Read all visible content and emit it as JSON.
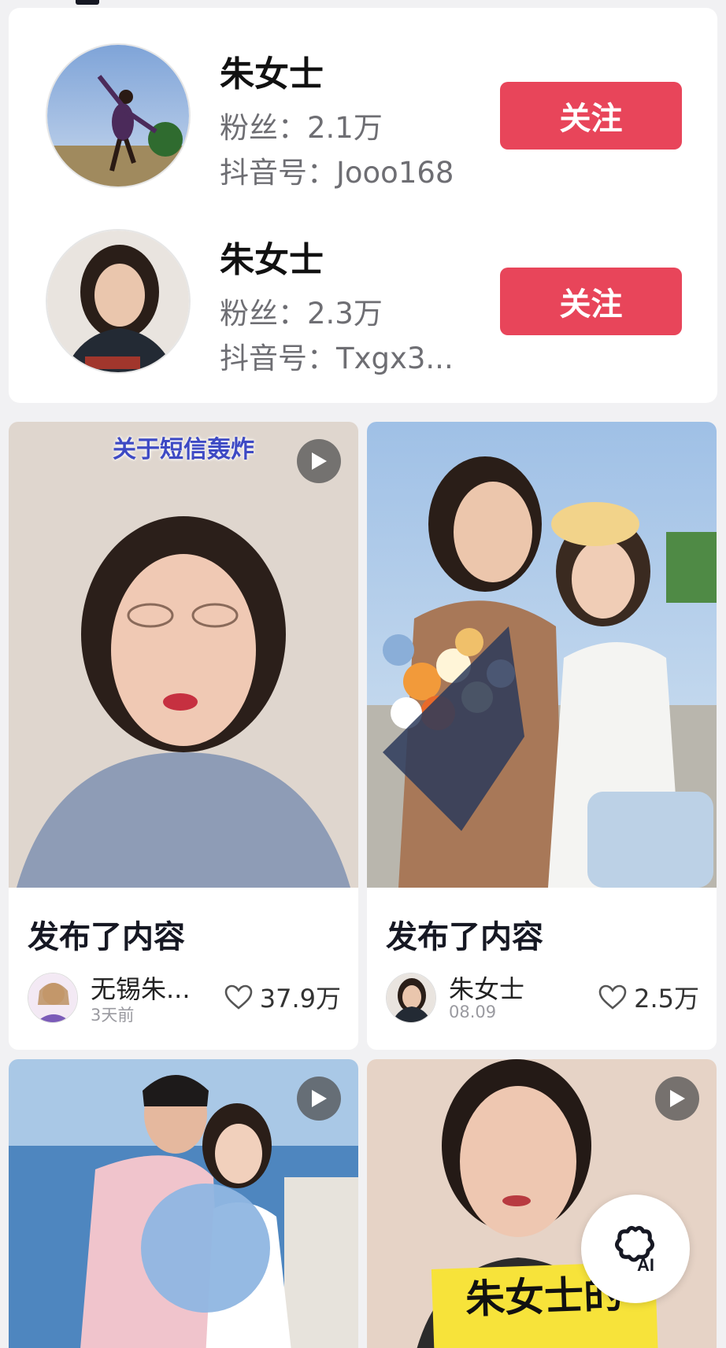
{
  "users": [
    {
      "name": "朱女士",
      "fans": "粉丝：2.1万",
      "douyin_id": "抖音号：Jooo168",
      "follow_label": "关注"
    },
    {
      "name": "朱女士",
      "fans": "粉丝：2.3万",
      "douyin_id": "抖音号：Txgx3...",
      "follow_label": "关注"
    }
  ],
  "videos": [
    {
      "caption": "关于短信轰炸",
      "title": "发布了内容",
      "author": "无锡朱...",
      "time": "3天前",
      "likes": "37.9万"
    },
    {
      "caption": "",
      "title": "发布了内容",
      "author": "朱女士",
      "time": "08.09",
      "likes": "2.5万"
    },
    {
      "caption": ""
    },
    {
      "caption": "",
      "sign_text": "朱女士的"
    }
  ],
  "ai_button": {
    "label": "AI"
  },
  "colors": {
    "follow_button": "#e8455a",
    "background": "#f1f1f3",
    "caption_text": "#3e4ac4"
  }
}
